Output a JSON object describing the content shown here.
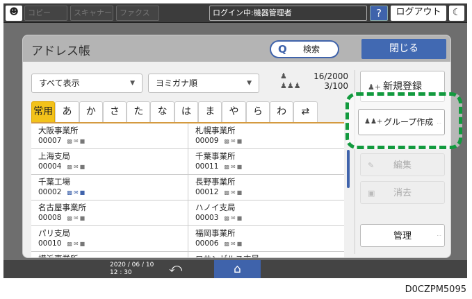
{
  "topbar": {
    "copy": "コピー",
    "scanner": "スキャナー",
    "fax": "ファクス",
    "login": "ログイン中:機器管理者",
    "help": "?",
    "logout": "ログアウト",
    "sleep": "☾"
  },
  "panel": {
    "title": "アドレス帳",
    "search": "検索",
    "close": "閉じる"
  },
  "filters": {
    "display": "すべて表示",
    "sort": "ヨミガナ順"
  },
  "counts": {
    "users": "16/2000",
    "groups": "3/100"
  },
  "tabs": [
    "常用",
    "あ",
    "か",
    "さ",
    "た",
    "な",
    "は",
    "ま",
    "や",
    "ら",
    "わ",
    "⇄"
  ],
  "entries": [
    {
      "name": "大阪事業所",
      "id": "00007",
      "selected": false
    },
    {
      "name": "札幌事業所",
      "id": "00009",
      "selected": false
    },
    {
      "name": "上海支局",
      "id": "00004",
      "selected": false
    },
    {
      "name": "千葉事業所",
      "id": "00011",
      "selected": false
    },
    {
      "name": "千葉工場",
      "id": "00002",
      "selected": true
    },
    {
      "name": "長野事業所",
      "id": "00012",
      "selected": false
    },
    {
      "name": "名古屋事業所",
      "id": "00008",
      "selected": false
    },
    {
      "name": "ハノイ支局",
      "id": "00003",
      "selected": false
    },
    {
      "name": "パリ支局",
      "id": "00010",
      "selected": false
    },
    {
      "name": "福岡事業所",
      "id": "00006",
      "selected": false
    },
    {
      "name": "横浜事業所",
      "id": "",
      "selected": false
    },
    {
      "name": "ロサンゼルス支局",
      "id": "",
      "selected": false
    }
  ],
  "actions": {
    "new": "新規登録",
    "group": "グループ作成",
    "edit": "編集",
    "delete": "消去",
    "manage": "管理"
  },
  "footer": {
    "date": "2020 / 06 / 10",
    "time": "12 : 30"
  },
  "caption": "D0CZPM5095",
  "colors": {
    "accent": "#3f63ab",
    "tab_active": "#f2c21a",
    "highlight": "#129a3e"
  }
}
